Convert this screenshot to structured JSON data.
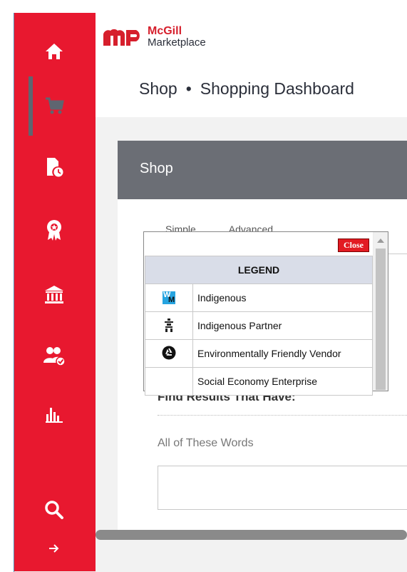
{
  "app": {
    "logo_top": "McGill",
    "logo_bottom": "Marketplace"
  },
  "breadcrumb": {
    "first": "Shop",
    "separator": "•",
    "second": "Shopping Dashboard"
  },
  "sidebar": {
    "items": [
      {
        "icon": "home-icon"
      },
      {
        "icon": "cart-icon",
        "active": true
      },
      {
        "icon": "document-clock-icon"
      },
      {
        "icon": "award-icon"
      },
      {
        "icon": "bank-icon"
      },
      {
        "icon": "users-check-icon"
      },
      {
        "icon": "bar-chart-icon"
      },
      {
        "icon": "search-icon"
      },
      {
        "icon": "arrow-right-icon"
      }
    ],
    "color": "#e8182f"
  },
  "panel": {
    "title": "Shop",
    "tabs": [
      "Simple",
      "Advanced"
    ],
    "find_label": "Find Results That Have:",
    "words_label": "All of These Words",
    "words_value": ""
  },
  "legend_popup": {
    "close_label": "Close",
    "header": "LEGEND",
    "rows": [
      {
        "icon": "wm-icon",
        "label": "Indigenous"
      },
      {
        "icon": "inukshuk-icon",
        "label": "Indigenous Partner"
      },
      {
        "icon": "recycle-icon",
        "label": "Environmentally Friendly Vendor"
      },
      {
        "icon": "",
        "label": "Social Economy Enterprise"
      }
    ]
  }
}
